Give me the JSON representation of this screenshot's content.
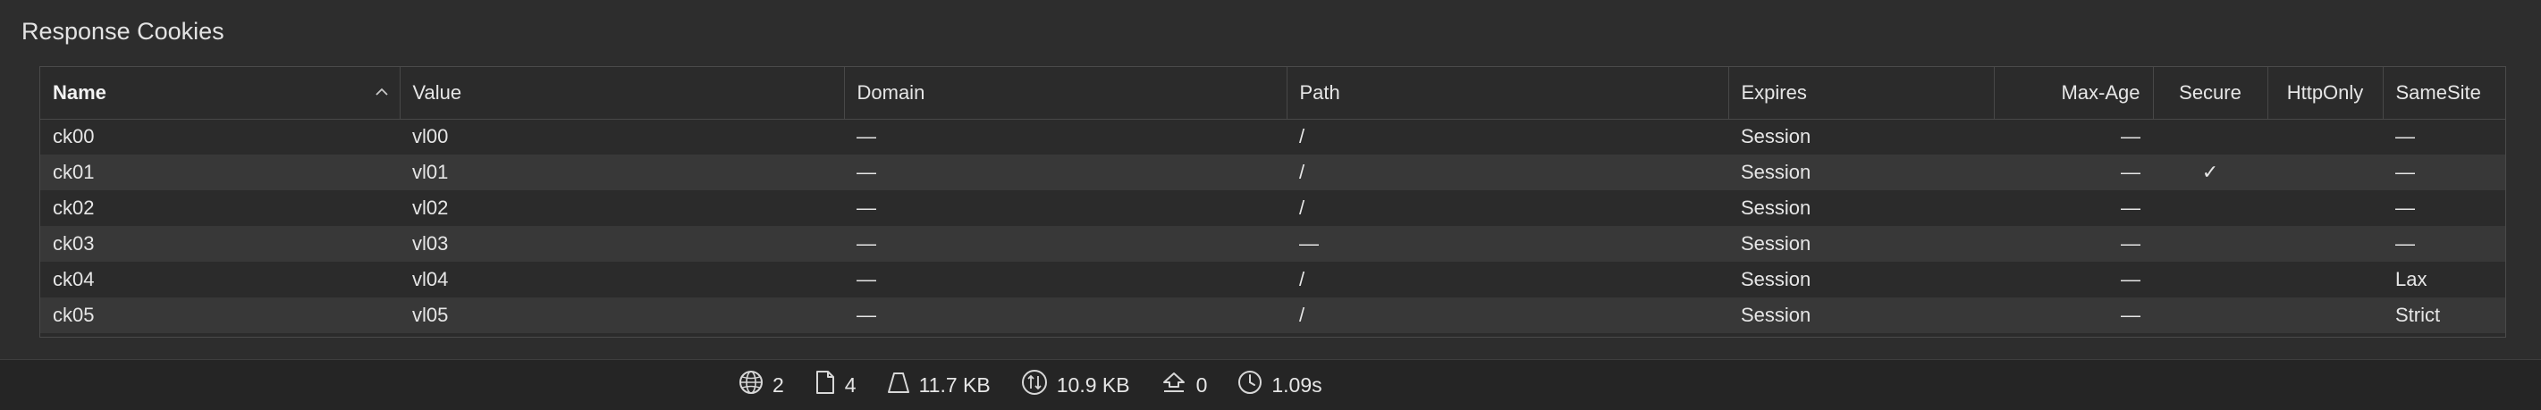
{
  "section": {
    "title": "Response Cookies"
  },
  "columns": [
    {
      "key": "name",
      "label": "Name"
    },
    {
      "key": "value",
      "label": "Value"
    },
    {
      "key": "domain",
      "label": "Domain"
    },
    {
      "key": "path",
      "label": "Path"
    },
    {
      "key": "expires",
      "label": "Expires"
    },
    {
      "key": "maxage",
      "label": "Max-Age"
    },
    {
      "key": "secure",
      "label": "Secure"
    },
    {
      "key": "httponly",
      "label": "HttpOnly"
    },
    {
      "key": "samesite",
      "label": "SameSite"
    }
  ],
  "sort_indicator": "^",
  "rows": [
    {
      "name": "ck00",
      "value": "vl00",
      "domain": "—",
      "path": "/",
      "expires": "Session",
      "maxage": "—",
      "secure": "",
      "httponly": "",
      "samesite": "—"
    },
    {
      "name": "ck01",
      "value": "vl01",
      "domain": "—",
      "path": "/",
      "expires": "Session",
      "maxage": "—",
      "secure": "✓",
      "httponly": "",
      "samesite": "—"
    },
    {
      "name": "ck02",
      "value": "vl02",
      "domain": "—",
      "path": "/",
      "expires": "Session",
      "maxage": "—",
      "secure": "",
      "httponly": "",
      "samesite": "—"
    },
    {
      "name": "ck03",
      "value": "vl03",
      "domain": "—",
      "path": "—",
      "expires": "Session",
      "maxage": "—",
      "secure": "",
      "httponly": "",
      "samesite": "—"
    },
    {
      "name": "ck04",
      "value": "vl04",
      "domain": "—",
      "path": "/",
      "expires": "Session",
      "maxage": "—",
      "secure": "",
      "httponly": "",
      "samesite": "Lax"
    },
    {
      "name": "ck05",
      "value": "vl05",
      "domain": "—",
      "path": "/",
      "expires": "Session",
      "maxage": "—",
      "secure": "",
      "httponly": "",
      "samesite": "Strict"
    }
  ],
  "status": {
    "domains": {
      "icon": "globe-icon",
      "value": "2"
    },
    "resources": {
      "icon": "document-icon",
      "value": "4"
    },
    "size": {
      "icon": "weight-icon",
      "value": "11.7 KB"
    },
    "transferred": {
      "icon": "transfer-icon",
      "value": "10.9 KB"
    },
    "redirects": {
      "icon": "redirect-icon",
      "value": "0"
    },
    "time": {
      "icon": "clock-icon",
      "value": "1.09s"
    }
  }
}
